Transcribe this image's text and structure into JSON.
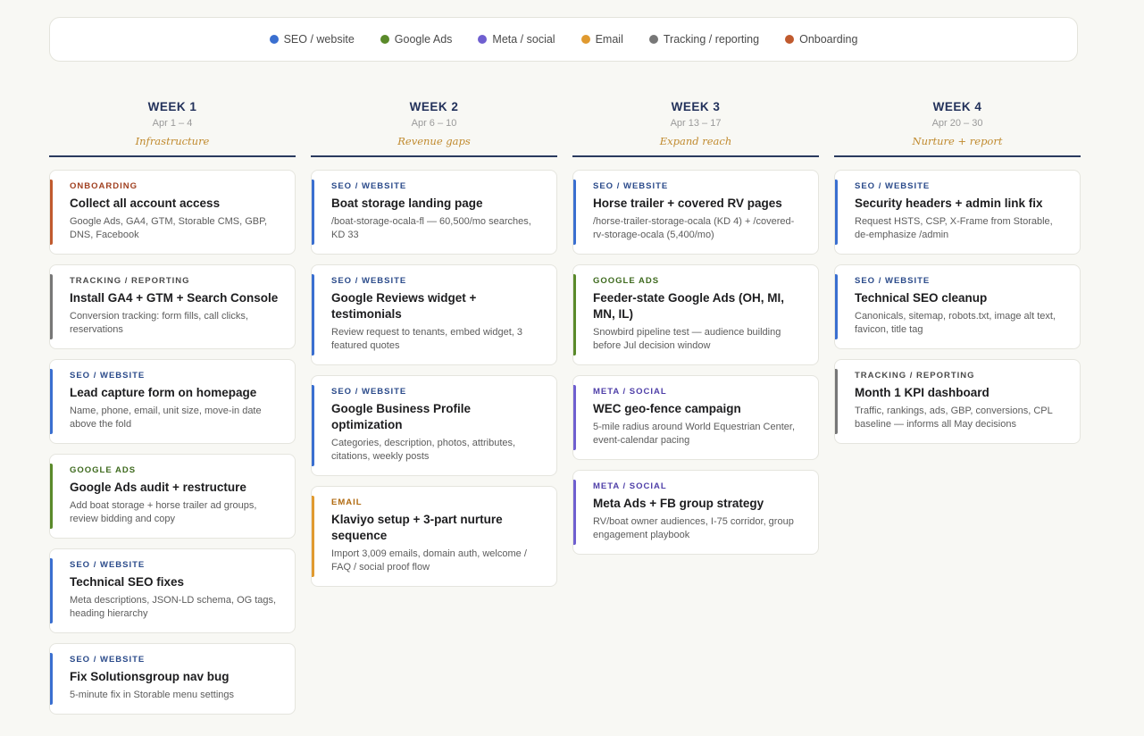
{
  "legend": [
    {
      "label": "SEO / website",
      "color": "#3a6fd0"
    },
    {
      "label": "Google Ads",
      "color": "#5a8a2a"
    },
    {
      "label": "Meta / social",
      "color": "#6f5fd0"
    },
    {
      "label": "Email",
      "color": "#e09a30"
    },
    {
      "label": "Tracking / reporting",
      "color": "#777777"
    },
    {
      "label": "Onboarding",
      "color": "#c05a2e"
    }
  ],
  "weeks": [
    {
      "title": "WEEK 1",
      "dates": "Apr 1 – 4",
      "theme": "Infrastructure",
      "cards": [
        {
          "tag": "ONBOARDING",
          "category": "onboarding",
          "title": "Collect all account access",
          "desc": "Google Ads, GA4, GTM, Storable CMS, GBP, DNS, Facebook"
        },
        {
          "tag": "TRACKING / REPORTING",
          "category": "tracking",
          "title": "Install GA4 + GTM + Search Console",
          "desc": "Conversion tracking: form fills, call clicks, reservations"
        },
        {
          "tag": "SEO / WEBSITE",
          "category": "seo",
          "title": "Lead capture form on homepage",
          "desc": "Name, phone, email, unit size, move-in date above the fold"
        },
        {
          "tag": "GOOGLE ADS",
          "category": "ads",
          "title": "Google Ads audit + restructure",
          "desc": "Add boat storage + horse trailer ad groups, review bidding and copy"
        },
        {
          "tag": "SEO / WEBSITE",
          "category": "seo",
          "title": "Technical SEO fixes",
          "desc": "Meta descriptions, JSON-LD schema, OG tags, heading hierarchy"
        },
        {
          "tag": "SEO / WEBSITE",
          "category": "seo",
          "title": "Fix Solutionsgroup nav bug",
          "desc": "5-minute fix in Storable menu settings"
        }
      ]
    },
    {
      "title": "WEEK 2",
      "dates": "Apr 6 – 10",
      "theme": "Revenue gaps",
      "cards": [
        {
          "tag": "SEO / WEBSITE",
          "category": "seo",
          "title": "Boat storage landing page",
          "desc": "/boat-storage-ocala-fl — 60,500/mo searches, KD 33"
        },
        {
          "tag": "SEO / WEBSITE",
          "category": "seo",
          "title": "Google Reviews widget + testimonials",
          "desc": "Review request to tenants, embed widget, 3 featured quotes"
        },
        {
          "tag": "SEO / WEBSITE",
          "category": "seo",
          "title": "Google Business Profile optimization",
          "desc": "Categories, description, photos, attributes, citations, weekly posts"
        },
        {
          "tag": "EMAIL",
          "category": "email",
          "title": "Klaviyo setup + 3-part nurture sequence",
          "desc": "Import 3,009 emails, domain auth, welcome / FAQ / social proof flow"
        }
      ]
    },
    {
      "title": "WEEK 3",
      "dates": "Apr 13 – 17",
      "theme": "Expand reach",
      "cards": [
        {
          "tag": "SEO / WEBSITE",
          "category": "seo",
          "title": "Horse trailer + covered RV pages",
          "desc": "/horse-trailer-storage-ocala (KD 4) + /covered-rv-storage-ocala (5,400/mo)"
        },
        {
          "tag": "GOOGLE ADS",
          "category": "ads",
          "title": "Feeder-state Google Ads (OH, MI, MN, IL)",
          "desc": "Snowbird pipeline test — audience building before Jul decision window"
        },
        {
          "tag": "META / SOCIAL",
          "category": "meta",
          "title": "WEC geo-fence campaign",
          "desc": "5-mile radius around World Equestrian Center, event-calendar pacing"
        },
        {
          "tag": "META / SOCIAL",
          "category": "meta",
          "title": "Meta Ads + FB group strategy",
          "desc": "RV/boat owner audiences, I-75 corridor, group engagement playbook"
        }
      ]
    },
    {
      "title": "WEEK 4",
      "dates": "Apr 20 – 30",
      "theme": "Nurture + report",
      "cards": [
        {
          "tag": "SEO / WEBSITE",
          "category": "seo",
          "title": "Security headers + admin link fix",
          "desc": "Request HSTS, CSP, X-Frame from Storable, de-emphasize /admin"
        },
        {
          "tag": "SEO / WEBSITE",
          "category": "seo",
          "title": "Technical SEO cleanup",
          "desc": "Canonicals, sitemap, robots.txt, image alt text, favicon, title tag"
        },
        {
          "tag": "TRACKING / REPORTING",
          "category": "tracking",
          "title": "Month 1 KPI dashboard",
          "desc": "Traffic, rankings, ads, GBP, conversions, CPL baseline — informs all May decisions"
        }
      ]
    }
  ],
  "category_colors": {
    "seo": {
      "bar": "#3a6fd0",
      "tag": "#2a4a8a"
    },
    "ads": {
      "bar": "#5a8a2a",
      "tag": "#3e6a1e"
    },
    "meta": {
      "bar": "#6f5fd0",
      "tag": "#4f3fa8"
    },
    "email": {
      "bar": "#e09a30",
      "tag": "#b06a10"
    },
    "tracking": {
      "bar": "#777777",
      "tag": "#4a4a4a"
    },
    "onboarding": {
      "bar": "#c05a2e",
      "tag": "#a04020"
    }
  }
}
